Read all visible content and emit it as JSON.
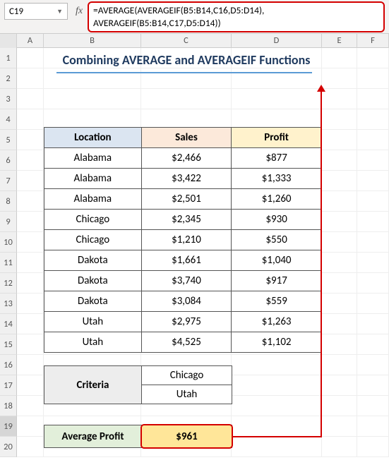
{
  "namebox": {
    "ref": "C19"
  },
  "formula_bar": {
    "line1": "=AVERAGE(AVERAGEIF(B5:B14,C16,D5:D14),",
    "line2": "AVERAGEIF(B5:B14,C17,D5:D14))"
  },
  "columns": {
    "corner": "",
    "A": "A",
    "B": "B",
    "C": "C",
    "D": "D",
    "E": "E",
    "F": "F"
  },
  "rows": [
    "1",
    "2",
    "3",
    "4",
    "5",
    "6",
    "7",
    "8",
    "9",
    "10",
    "11",
    "12",
    "13",
    "14",
    "15",
    "16",
    "17",
    "18",
    "19",
    "20"
  ],
  "title": "Combining AVERAGE and AVERAGEIF Functions",
  "headers": {
    "location": "Location",
    "sales": "Sales",
    "profit": "Profit"
  },
  "table": [
    {
      "location": "Alabama",
      "sales": "$2,466",
      "profit": "$877"
    },
    {
      "location": "Alabama",
      "sales": "$3,422",
      "profit": "$1,333"
    },
    {
      "location": "Alabama",
      "sales": "$2,501",
      "profit": "$1,260"
    },
    {
      "location": "Chicago",
      "sales": "$2,345",
      "profit": "$930"
    },
    {
      "location": "Chicago",
      "sales": "$1,210",
      "profit": "$550"
    },
    {
      "location": "Dakota",
      "sales": "$1,661",
      "profit": "$1,040"
    },
    {
      "location": "Dakota",
      "sales": "$3,740",
      "profit": "$917"
    },
    {
      "location": "Dakota",
      "sales": "$3,084",
      "profit": "$559"
    },
    {
      "location": "Utah",
      "sales": "$2,975",
      "profit": "$1,263"
    },
    {
      "location": "Utah",
      "sales": "$4,525",
      "profit": "$1,102"
    }
  ],
  "criteria": {
    "label": "Criteria",
    "values": [
      "Chicago",
      "Utah"
    ]
  },
  "result": {
    "label": "Average Profit",
    "value": "$961"
  },
  "icons": {
    "fx": "fx",
    "dropdown": "▼"
  }
}
